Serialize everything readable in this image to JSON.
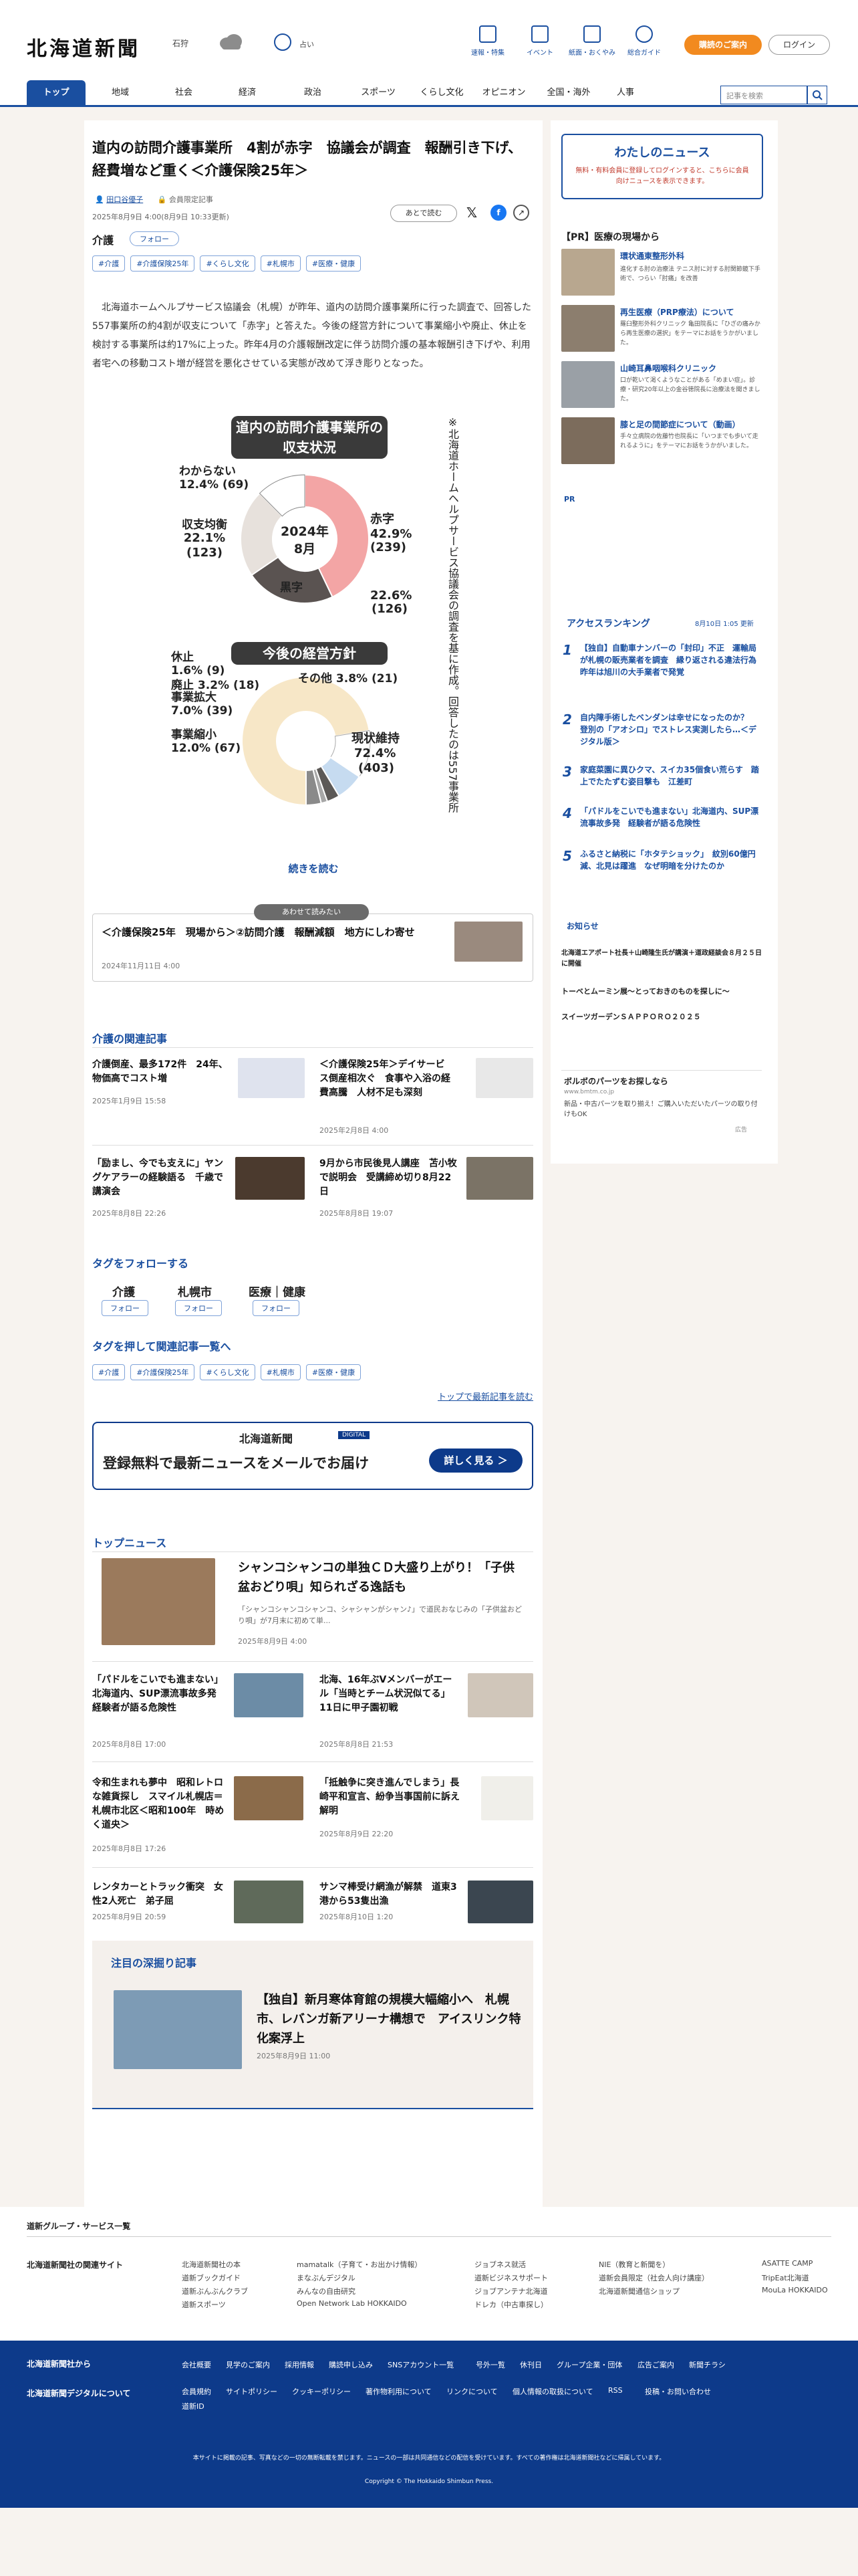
{
  "header": {
    "logo": "北海道新聞",
    "weather_city": "石狩",
    "weather_text": "占い",
    "icons": [
      {
        "label": "速報・特集",
        "icon": "flag-icon"
      },
      {
        "label": "イベント",
        "icon": "calendar-icon"
      },
      {
        "label": "紙面・おくやみ",
        "icon": "newspaper-icon"
      },
      {
        "label": "総合ガイド",
        "icon": "help-icon"
      }
    ],
    "subscribe": "購読のご案内",
    "login": "ログイン"
  },
  "nav": {
    "items": [
      "トップ",
      "地域",
      "社会",
      "経済",
      "政治",
      "スポーツ",
      "くらし文化",
      "オピニオン",
      "全国・海外",
      "人事"
    ],
    "search_placeholder": "記事を検索"
  },
  "article": {
    "title": "道内の訪問介護事業所　4割が赤字　協議会が調査　報酬引き下げ、経費増など重く＜介護保険25年＞",
    "author": "田口谷優子",
    "member": "会員限定記事",
    "date": "2025年8月9日 4:00(8月9日 10:33更新)",
    "read_later": "あとで読む",
    "tag_label": "介護",
    "follow": "フォロー",
    "tags": [
      "#介護",
      "#介護保険25年",
      "#くらし文化",
      "#札幌市",
      "#医療・健康"
    ],
    "body": "北海道ホームヘルプサービス協議会（札幌）が昨年、道内の訪問介護事業所に行った調査で、回答した557事業所の約4割が収支について「赤字」と答えた。今後の経営方針について事業縮小や廃止、休止を検討する事業所は約17%に上った。昨年4月の介護報酬改定に伴う訪問介護の基本報酬引き下げや、利用者宅への移動コスト増が経営を悪化させている実態が改めて浮き彫りとなった。",
    "read_more": "続きを読む"
  },
  "chart_data": [
    {
      "type": "pie",
      "title": "道内の訪問介護事業所の収支状況",
      "center_label": "2024年8月",
      "slices": [
        {
          "name": "赤字",
          "percent": 42.9,
          "count": 239
        },
        {
          "name": "黒字",
          "percent": 22.6,
          "count": 126
        },
        {
          "name": "収支均衡",
          "percent": 22.1,
          "count": 123
        },
        {
          "name": "わからない",
          "percent": 12.4,
          "count": 69
        }
      ]
    },
    {
      "type": "pie",
      "title": "今後の経営方針",
      "slices": [
        {
          "name": "現状維持",
          "percent": 72.4,
          "count": 403
        },
        {
          "name": "事業縮小",
          "percent": 12.0,
          "count": 67
        },
        {
          "name": "事業拡大",
          "percent": 7.0,
          "count": 39
        },
        {
          "name": "廃止",
          "percent": 3.2,
          "count": 18
        },
        {
          "name": "休止",
          "percent": 1.6,
          "count": 9
        },
        {
          "name": "その他",
          "percent": 3.8,
          "count": 21
        }
      ]
    }
  ],
  "chart_note": "※北海道ホームヘルプサービス協議会の調査を基に作成。回答したのは557事業所",
  "recommend": {
    "badge": "あわせて読みたい",
    "title": "＜介護保険25年　現場から＞②訪問介護　報酬減額　地方にしわ寄せ",
    "date": "2024年11月11日 4:00"
  },
  "related": {
    "heading": "介護の関連記事",
    "items": [
      {
        "title": "介護倒産、最多172件　24年、物価高でコスト増",
        "date": "2025年1月9日 15:58"
      },
      {
        "title": "＜介護保険25年＞デイサービス倒産相次ぐ　食事や入浴の経費高騰　人材不足も深刻",
        "date": "2025年2月8日 4:00"
      },
      {
        "title": "「励まし、今でも支えに」ヤングケアラーの経験語る　千歳で講演会",
        "date": "2025年8月8日 22:26"
      },
      {
        "title": "9月から市民後見人講座　苫小牧で説明会　受講締め切り8月22日",
        "date": "2025年8月8日 19:07"
      }
    ]
  },
  "follow_tags": {
    "heading": "タグをフォローする",
    "items": [
      "介護",
      "札幌市",
      "医療｜健康"
    ],
    "follow": "フォロー"
  },
  "tag_list": {
    "heading": "タグを押して関連記事一覧へ",
    "items": [
      "#介護",
      "#介護保険25年",
      "#くらし文化",
      "#札幌市",
      "#医療・健康"
    ]
  },
  "back_top": "トップで最新記事を読む",
  "banner": {
    "brand": "北海道新聞",
    "brand_sub": "DIGITAL",
    "text": "登録無料で最新ニュースをメールでお届け",
    "button": "詳しく見る ＞"
  },
  "top_news": {
    "heading": "トップニュース",
    "lead": {
      "title": "シャンコシャンコの単独ＣＤ大盛り上がり！「子供盆おどり唄」知られざる逸話も",
      "desc": "「シャンコシャンコシャンコ、シャシャンがシャン♪」で道民おなじみの「子供盆おどり唄」が7月末に初めて単...",
      "date": "2025年8月9日 4:00"
    },
    "items": [
      {
        "title": "「パドルをこいでも進まない」北海道内、SUP漂流事故多発　経験者が語る危険性",
        "date": "2025年8月8日 17:00"
      },
      {
        "title": "北海、16年ぶVメンバーがエール「当時とチーム状況似てる」 11日に甲子園初戦",
        "date": "2025年8月8日 21:53"
      },
      {
        "title": "令和生まれも夢中　昭和レトロな雑貨探し　スマイル札幌店＝札幌市北区＜昭和100年　時めく道央＞",
        "date": "2025年8月8日 17:26"
      },
      {
        "title": "「抵触争に突き進んでしまう」長崎平和宣言、紛争当事国前に訴え解明",
        "date": "2025年8月9日 22:20"
      },
      {
        "title": "レンタカーとトラック衝突　女性2人死亡　弟子屈",
        "date": "2025年8月9日 20:59"
      },
      {
        "title": "サンマ棒受け網漁が解禁　道東3港から53隻出漁",
        "date": "2025年8月10日 1:20"
      }
    ]
  },
  "deep": {
    "heading": "注目の深掘り記事",
    "title": "【独自】新月寒体育館の規模大幅縮小へ　札幌市、レバンガ新アリーナ構想で　アイスリンク特化案浮上",
    "date": "2025年8月9日 11:00"
  },
  "side": {
    "mynews_title": "わたしのニュース",
    "mynews_text": "無料・有料会員に登録してログインすると、こちらに会員向けニュースを表示できます。",
    "pr_heading": "【PR】医療の現場から",
    "pr_items": [
      {
        "title": "環状通東整形外科",
        "text": "進化する肘の治療法 テニス肘に対する肘関節鏡下手術で、つらい「肘痛」を改善"
      },
      {
        "title": "再生医療（PRP療法）について",
        "text": "羅臼整形外科クリニック 亀田院長に「ひざの痛みから再生医療の選択」をテーマにお話をうかがいました。"
      },
      {
        "title": "山崎耳鼻咽喉科クリニック",
        "text": "口が乾いて渇くようなことがある「めまい症」。診療・研究20年以上の金谷徳院長に治療法を聞きました。"
      },
      {
        "title": "膝と足の間節症について（動画）",
        "text": "手々立病院の佐藤竹也院長に「いつまでも歩いて走れるように」をテーマにお話をうかがいました。"
      }
    ],
    "pr_badge": "PR",
    "ranking_heading": "アクセスランキング",
    "ranking_time": "8月10日 1:05 更新",
    "ranking": [
      {
        "n": "1",
        "t": "【独自】自動車ナンバーの「封印」不正　運輸局が札幌の販売業者を調査　縁り返される違法行為　昨年は旭川の大手業者で発覚"
      },
      {
        "n": "2",
        "t": "自内障手術したベンダンは幸せになったのか？　登別の「アオシロ」でストレス実測したら…＜デジタル版＞"
      },
      {
        "n": "3",
        "t": "家庭菜園に異ひクマ、スイカ35個食い荒らす　踏上でたたずむ姿目撃も　江差町"
      },
      {
        "n": "4",
        "t": "「パドルをこいでも進まない」北海道内、SUP漂流事故多発　経験者が語る危険性"
      },
      {
        "n": "5",
        "t": "ふるさと納税に「ホタテショック」　紋別60億円減、北見は躍進　なぜ明暗を分けたのか"
      }
    ],
    "notice_heading": "お知らせ",
    "notices": [
      "北海道エアポート社長＋山崎隆生氏が講演＋道政経談会８月２５日に開催",
      "トーベとムーミン展～とっておきのものを探しに～",
      "スイーツガーデンＳＡＰＰＯＲＯ２０２５"
    ],
    "ad_title": "ボルボのパーツをお探しなら",
    "ad_url": "www.bmtm.co.jp",
    "ad_text": "新品・中古パーツを取り揃え！ご購入いただいたパーツの取り付けもOK",
    "ad_label": "広告"
  },
  "footer": {
    "group_heading": "道新グループ・サービス一覧",
    "related_heading": "北海道新聞社の関連サイト",
    "links": [
      [
        "北海道新聞社の本",
        "道新ブックガイド",
        "道新ぶんぶんクラブ",
        "道新スポーツ"
      ],
      [
        "mamatalk（子育て・お出かけ情報）",
        "まなぶんデジタル",
        "みんなの自由研究",
        "Open Network Lab HOKKAIDO"
      ],
      [
        "ジョブネス就活",
        "道新ビジネスサポート",
        "ジョブアンテナ北海道",
        "ドレカ（中古車探し）"
      ],
      [
        "NIE（教育と新聞を）",
        "道新会員限定（社会人向け講座）",
        "北海道新聞通信ショップ"
      ],
      [
        "ASATTE CAMP",
        "TripEat北海道",
        "MouLa HOKKAIDO"
      ]
    ],
    "blue_left": [
      "北海道新聞社から",
      "北海道新聞デジタルについて"
    ],
    "blue_row1": [
      "会社概要",
      "見学のご案内",
      "採用情報",
      "購読申し込み",
      "SNSアカウント一覧",
      "号外一覧",
      "休刊日",
      "グループ企業・団体",
      "広告ご案内",
      "新聞チラシ"
    ],
    "blue_row2": [
      "会員規約",
      "サイトポリシー",
      "クッキーポリシー",
      "著作物利用について",
      "リンクについて",
      "個人情報の取扱について",
      "RSS",
      "投稿・お問い合わせ",
      "道新ID"
    ],
    "notice": "本サイトに掲載の記事、写真などの一切の無断転載を禁じます。ニュースの一部は共同通信などの配信を受けています。すべての著作権は北海道新聞社などに帰属しています。",
    "copyright": "Copyright © The Hokkaido Shimbun Press."
  }
}
